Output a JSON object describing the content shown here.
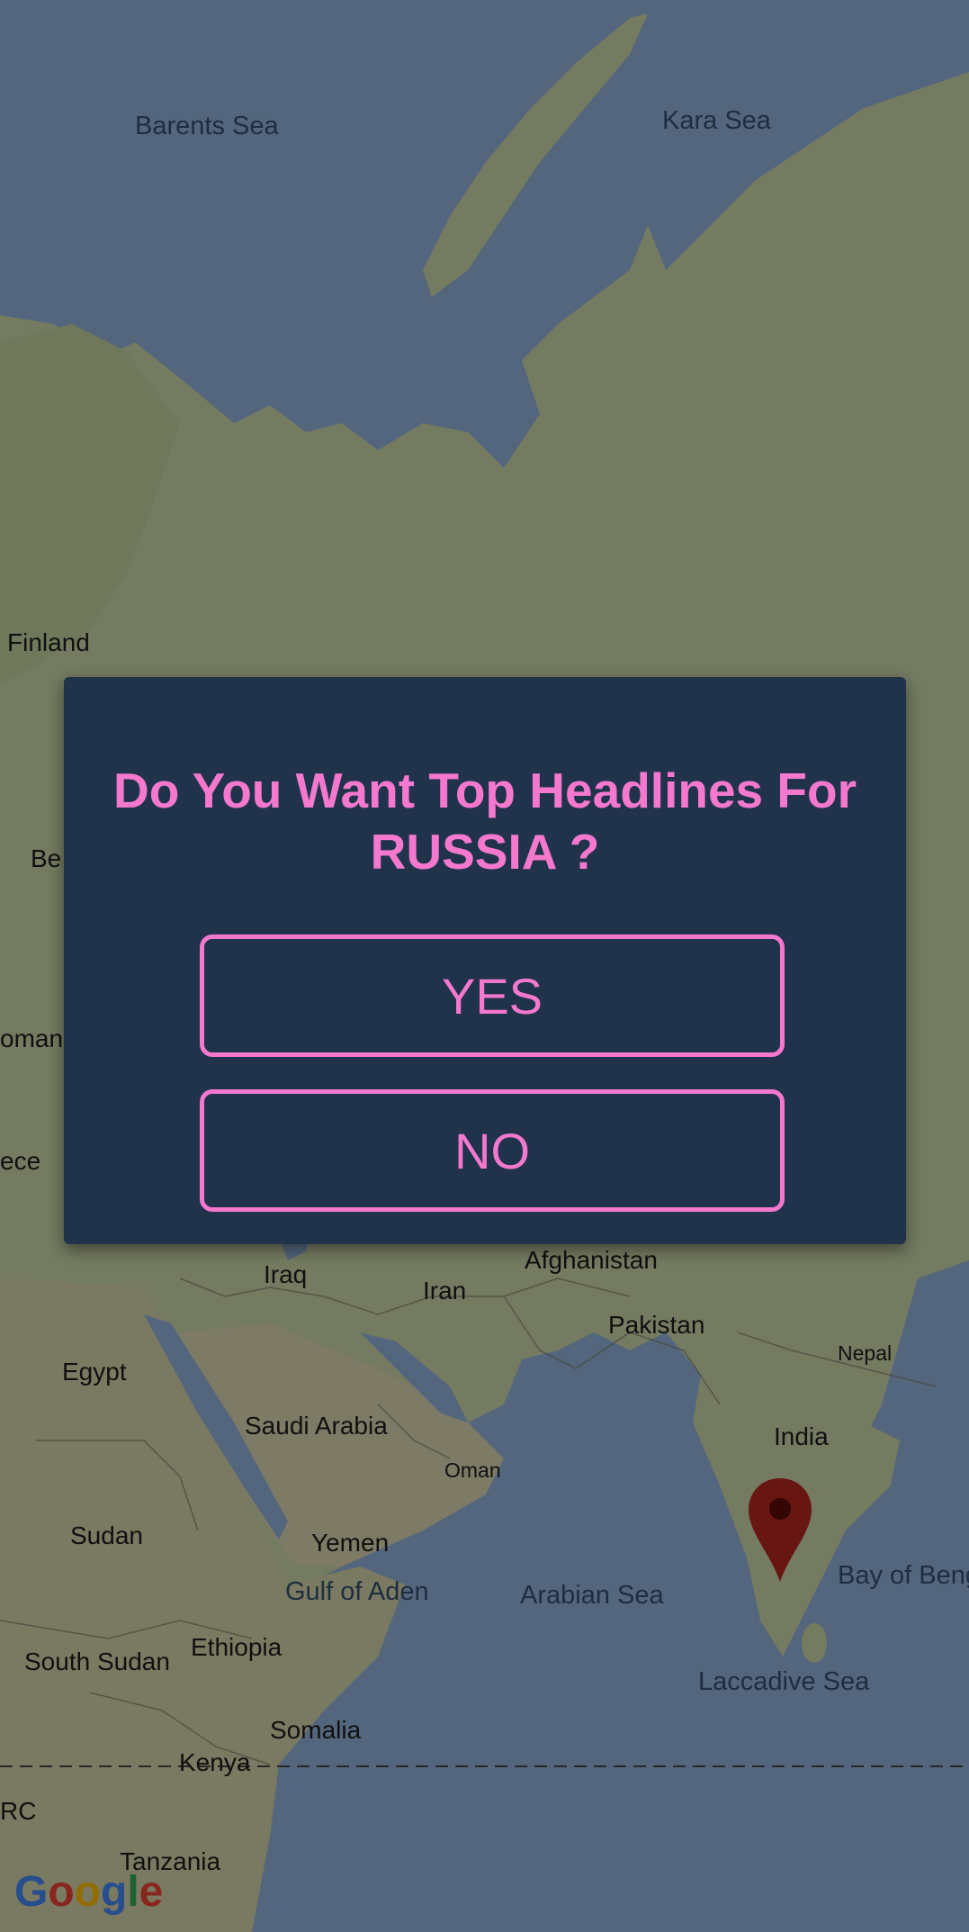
{
  "map": {
    "labels": {
      "barents_sea": "Barents Sea",
      "kara_sea": "Kara Sea",
      "finland": "Finland",
      "be": "Be",
      "oman_left": "oman",
      "ece": "ece",
      "iraq": "Iraq",
      "iran": "Iran",
      "afghanistan": "Afghanistan",
      "pakistan": "Pakistan",
      "nepal": "Nepal",
      "egypt": "Egypt",
      "saudi_arabia": "Saudi Arabia",
      "oman": "Oman",
      "india": "India",
      "sudan": "Sudan",
      "yemen": "Yemen",
      "gulf_of_aden": "Gulf of Aden",
      "arabian_sea": "Arabian Sea",
      "bay_of_bengal": "Bay of Beng",
      "south_sudan": "South Sudan",
      "ethiopia": "Ethiopia",
      "laccadive_sea": "Laccadive Sea",
      "somalia": "Somalia",
      "kenya": "Kenya",
      "drc": "RC",
      "tanzania": "Tanzania"
    },
    "attribution": [
      "G",
      "o",
      "o",
      "g",
      "l",
      "e"
    ],
    "logo_colors": [
      "#4285f4",
      "#ea4335",
      "#fbbc05",
      "#4285f4",
      "#34a853",
      "#ea4335"
    ]
  },
  "dialog": {
    "title": "Do You Want Top Headlines For RUSSIA ?",
    "yes_label": "YES",
    "no_label": "NO"
  },
  "colors": {
    "accent": "#f578cf",
    "dialog_bg": "#20334b",
    "marker": "#b3261e"
  }
}
